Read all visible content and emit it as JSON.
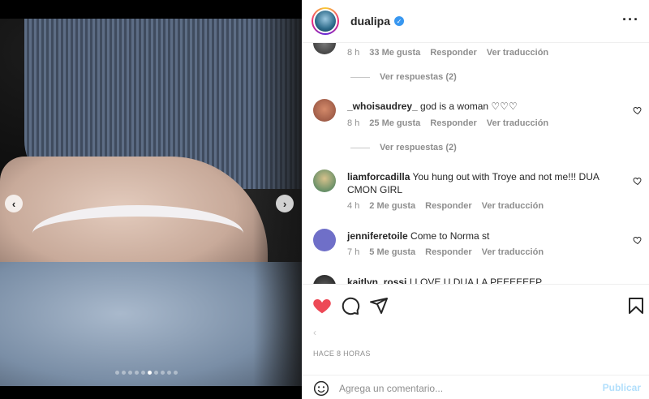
{
  "post": {
    "username": "dualipa",
    "carousel": {
      "total_slides": 10,
      "current_slide": 6
    }
  },
  "comments": [
    {
      "username": "",
      "text": "",
      "time": "8 h",
      "likes": "33 Me gusta",
      "reply_label": "Responder",
      "translate_label": "Ver traducción",
      "view_replies": "Ver respuestas (2)"
    },
    {
      "username": "_whoisaudrey_",
      "text": "god is a woman ♡♡♡",
      "time": "8 h",
      "likes": "25 Me gusta",
      "reply_label": "Responder",
      "translate_label": "Ver traducción",
      "view_replies": "Ver respuestas (2)"
    },
    {
      "username": "liamforcadilla",
      "text": "You hung out with Troye and not me!!! DUA CMON GIRL",
      "time": "4 h",
      "likes": "2 Me gusta",
      "reply_label": "Responder",
      "translate_label": "Ver traducción"
    },
    {
      "username": "jenniferetoile",
      "text": "Come to Norma st",
      "time": "7 h",
      "likes": "5 Me gusta",
      "reply_label": "Responder",
      "translate_label": "Ver traducción"
    },
    {
      "username": "kaitlyn_rossi",
      "text": "I LOVE U DUA LA PEEEEEEP"
    }
  ],
  "footer": {
    "timestamp": "HACE 8 HORAS",
    "comment_placeholder": "Agrega un comentario...",
    "publish_label": "Publicar"
  },
  "colors": {
    "like_red": "#ed4956",
    "verified_blue": "#3897f0",
    "muted_text": "#8e8e8e",
    "publish_disabled": "#b2dffc"
  },
  "icons": [
    "more-options-icon",
    "heart-icon",
    "comment-icon",
    "share-icon",
    "save-icon",
    "emoji-icon",
    "chevron-left-icon",
    "chevron-right-icon"
  ]
}
